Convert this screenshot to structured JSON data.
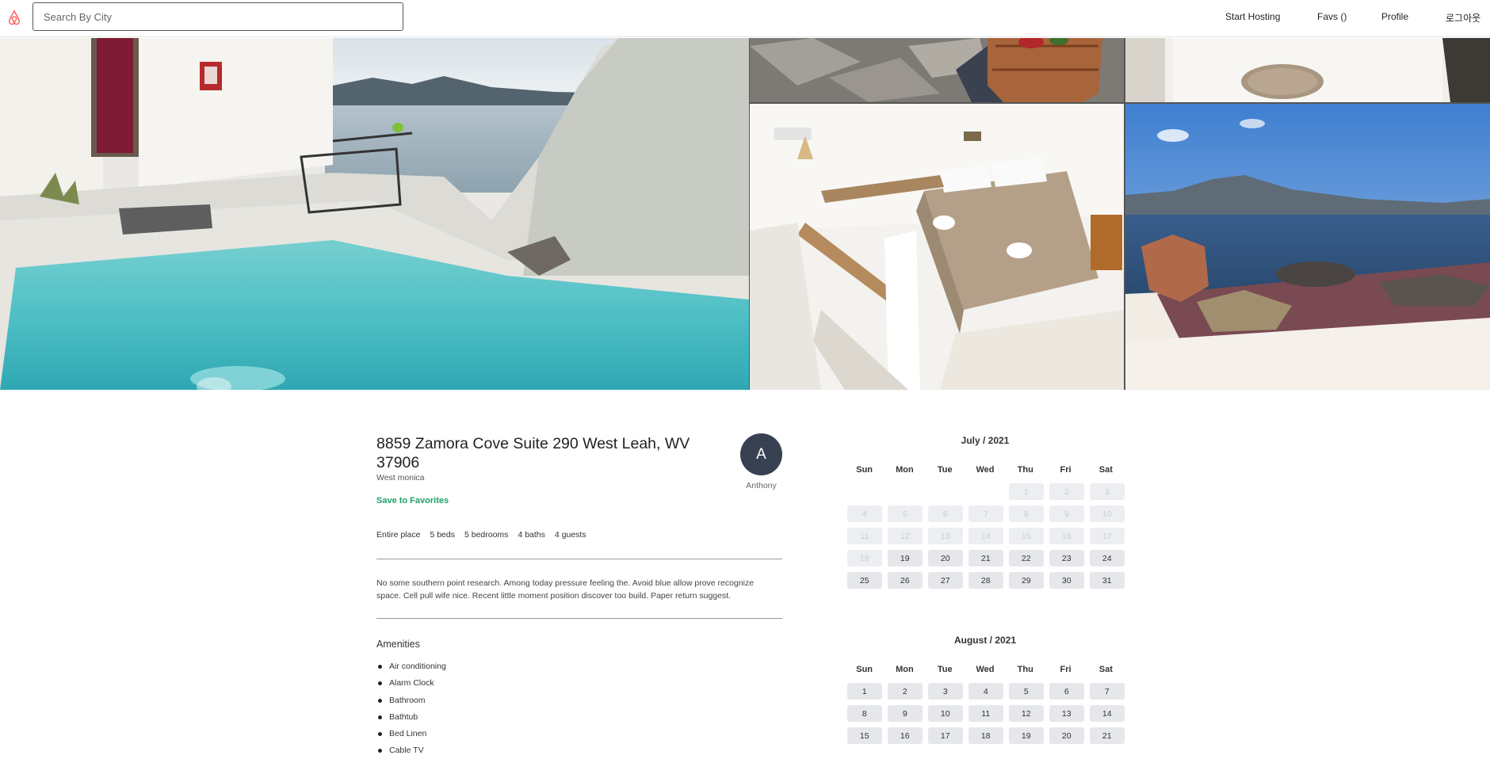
{
  "header": {
    "logo_icon": "airbnb-logo-icon",
    "search_placeholder": "Search By City",
    "nav": [
      "Start Hosting",
      "Favs ()",
      "Profile",
      "로그아웃"
    ]
  },
  "listing": {
    "address": "8859 Zamora Cove Suite 290 West Leah, WV 37906",
    "city": "West monica",
    "save_label": "Save to Favorites",
    "host": {
      "initial": "A",
      "name": "Anthony"
    },
    "features": [
      "Entire place",
      "5 beds",
      "5 bedrooms",
      "4 baths",
      "4 guests"
    ],
    "description": "No some southern point research. Among today pressure feeling the. Avoid blue allow prove recognize space. Cell pull wife nice. Recent little moment position discover too build. Paper return suggest.",
    "amenities_title": "Amenities",
    "amenities": [
      "Air conditioning",
      "Alarm Clock",
      "Bathroom",
      "Bathtub",
      "Bed Linen",
      "Cable TV"
    ]
  },
  "calendars": [
    {
      "title": "July / 2021",
      "weekdays": [
        "Sun",
        "Mon",
        "Tue",
        "Wed",
        "Thu",
        "Fri",
        "Sat"
      ],
      "lead_blanks": 4,
      "days": 31,
      "past_until": 18
    },
    {
      "title": "August / 2021",
      "weekdays": [
        "Sun",
        "Mon",
        "Tue",
        "Wed",
        "Thu",
        "Fri",
        "Sat"
      ],
      "lead_blanks": 0,
      "days_visible": 21,
      "past_until": 0
    }
  ],
  "colors": {
    "accent_green": "#22a06b",
    "avatar_bg": "#374151",
    "day_bg": "#e5e7eb",
    "brand": "#ff5a5f"
  }
}
